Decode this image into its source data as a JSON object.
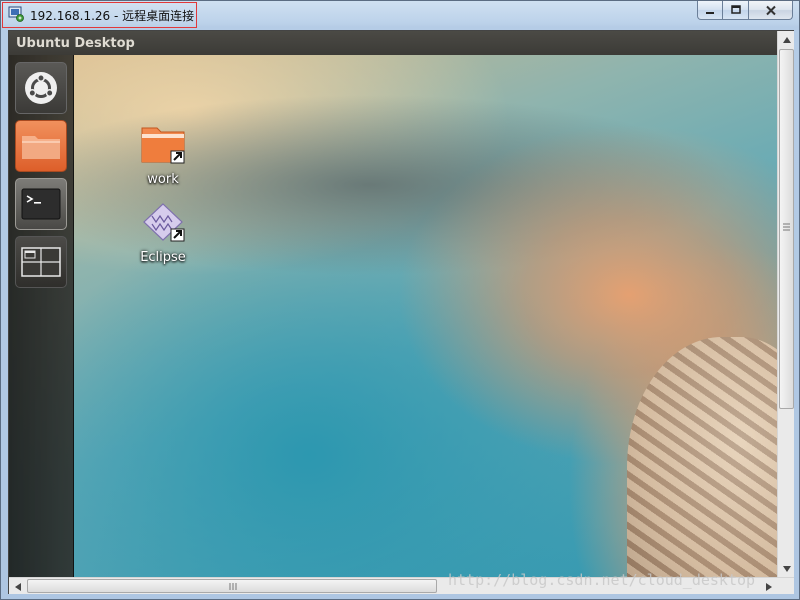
{
  "window": {
    "title": "192.168.1.26 - 远程桌面连接",
    "buttons": {
      "minimize": "—",
      "maximize": "□",
      "close": "✕"
    }
  },
  "ubuntu": {
    "panel_title": "Ubuntu Desktop",
    "launcher": [
      {
        "name": "dash",
        "icon": "ubuntu-logo-icon"
      },
      {
        "name": "files",
        "icon": "folder-icon"
      },
      {
        "name": "terminal",
        "icon": "terminal-icon"
      },
      {
        "name": "workspaces",
        "icon": "workspace-switcher-icon"
      }
    ],
    "desktop_icons": [
      {
        "label": "work",
        "icon": "folder-shortcut-icon"
      },
      {
        "label": "Eclipse",
        "icon": "eclipse-shortcut-icon"
      }
    ]
  },
  "watermark": "http://blog.csdn.net/cloud_desktop",
  "colors": {
    "title_highlight": "#e2383a",
    "ubuntu_orange": "#dd5f2a",
    "panel_bg": "#3c3b37"
  }
}
